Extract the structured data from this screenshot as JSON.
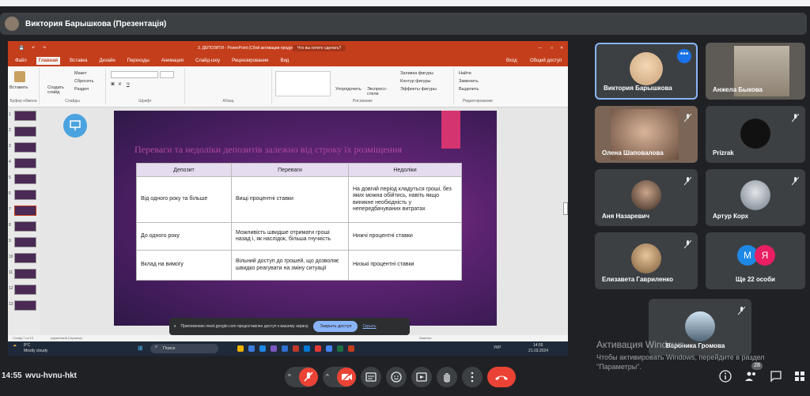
{
  "presenter_bar": {
    "title": "Виктория Барышкова (Презентація)"
  },
  "ppt": {
    "window_title": "3. ДЕПОЗИТИ - PowerPoint (Сбой активации продукта)",
    "search_hint": "Что вы хотите сделать?",
    "share_label": "Общий доступ",
    "login_label": "Вход",
    "tabs": [
      "Файл",
      "Главная",
      "Вставка",
      "Дизайн",
      "Переходы",
      "Анимация",
      "Слайд-шоу",
      "Рецензирование",
      "Вид"
    ],
    "ribbon": {
      "paste": "Вставить",
      "new_slide": "Создать слайд",
      "layout": "Макет",
      "reset": "Сбросить",
      "section": "Раздел",
      "arrange": "Упорядочить",
      "quick_styles": "Экспресс-стили",
      "fill": "Заливка фигуры",
      "outline": "Контур фигуры",
      "effects": "Эффекты фигуры",
      "find": "Найти",
      "replace": "Заменить",
      "select": "Выделить",
      "group_clipboard": "Буфер обмена",
      "group_slides": "Слайды",
      "group_font": "Шрифт",
      "group_paragraph": "Абзац",
      "group_drawing": "Рисование",
      "group_editing": "Редактирование"
    },
    "thumb_numbers": [
      "1",
      "2",
      "3",
      "4",
      "5",
      "6",
      "7",
      "8",
      "9",
      "10",
      "11",
      "12",
      "13"
    ],
    "status_left": "Слайд 7 из 13",
    "status_lang": "украинский (Украина)",
    "status_notes": "Заметки"
  },
  "slide": {
    "title": "Переваги та недоліки депозитів залежно від строку їх розміщення",
    "headers": [
      "Депозит",
      "Переваги",
      "Недоліки"
    ],
    "rows": [
      [
        "Від одного року та більше",
        "Вищі процентні ставки",
        "На довгий період кладуться гроші, без яких можна обійтись, навіть якщо виникне необхідність у непередбачуваних витратах"
      ],
      [
        "До одного року",
        "Можливість швидше отримати гроші назад і, як наслідок, більша гнучкість",
        "Нижчі процентні ставки"
      ],
      [
        "Вклад на вимогу",
        "Вільний доступ до грошей, що дозволяє швидко реагувати на зміну ситуації",
        "Низькі процентні ставки"
      ]
    ]
  },
  "share_notice": {
    "text": "Приложению meet.google.com предоставлен доступ к вашему экрану.",
    "stop": "Закрыть доступ",
    "hide": "Скрыть"
  },
  "taskbar": {
    "weather_temp": "8°C",
    "weather_desc": "Mostly cloudy",
    "search": "Поиск",
    "lang": "УКР",
    "time": "14:55",
    "date": "21.03.2024"
  },
  "participants": [
    {
      "name": "Виктория Барышкова"
    },
    {
      "name": "Анжела Быкова"
    },
    {
      "name": "Олена Шаповалова"
    },
    {
      "name": "Prizrak"
    },
    {
      "name": "Аня Назаревич"
    },
    {
      "name": "Артур Корх"
    },
    {
      "name": "Елизавета Гавриленко"
    },
    {
      "name": "Ще 22 особи",
      "letters": [
        "М",
        "Я"
      ]
    },
    {
      "name": "Вероника Громова"
    }
  ],
  "bottom_bar": {
    "time": "14:55",
    "meeting_code": "wvu-hvnu-hkt",
    "participants_badge": "28"
  },
  "windows_activation": {
    "line1": "Активация Windows",
    "line2": "Чтобы активировать Windows, перейдите в раздел \"Параметры\"."
  },
  "colors": {
    "accent_red": "#ea4335",
    "ppt_orange": "#c43e1c",
    "meet_dark": "#202124",
    "tile": "#3c4043",
    "pin_blue": "#1a73e8"
  }
}
